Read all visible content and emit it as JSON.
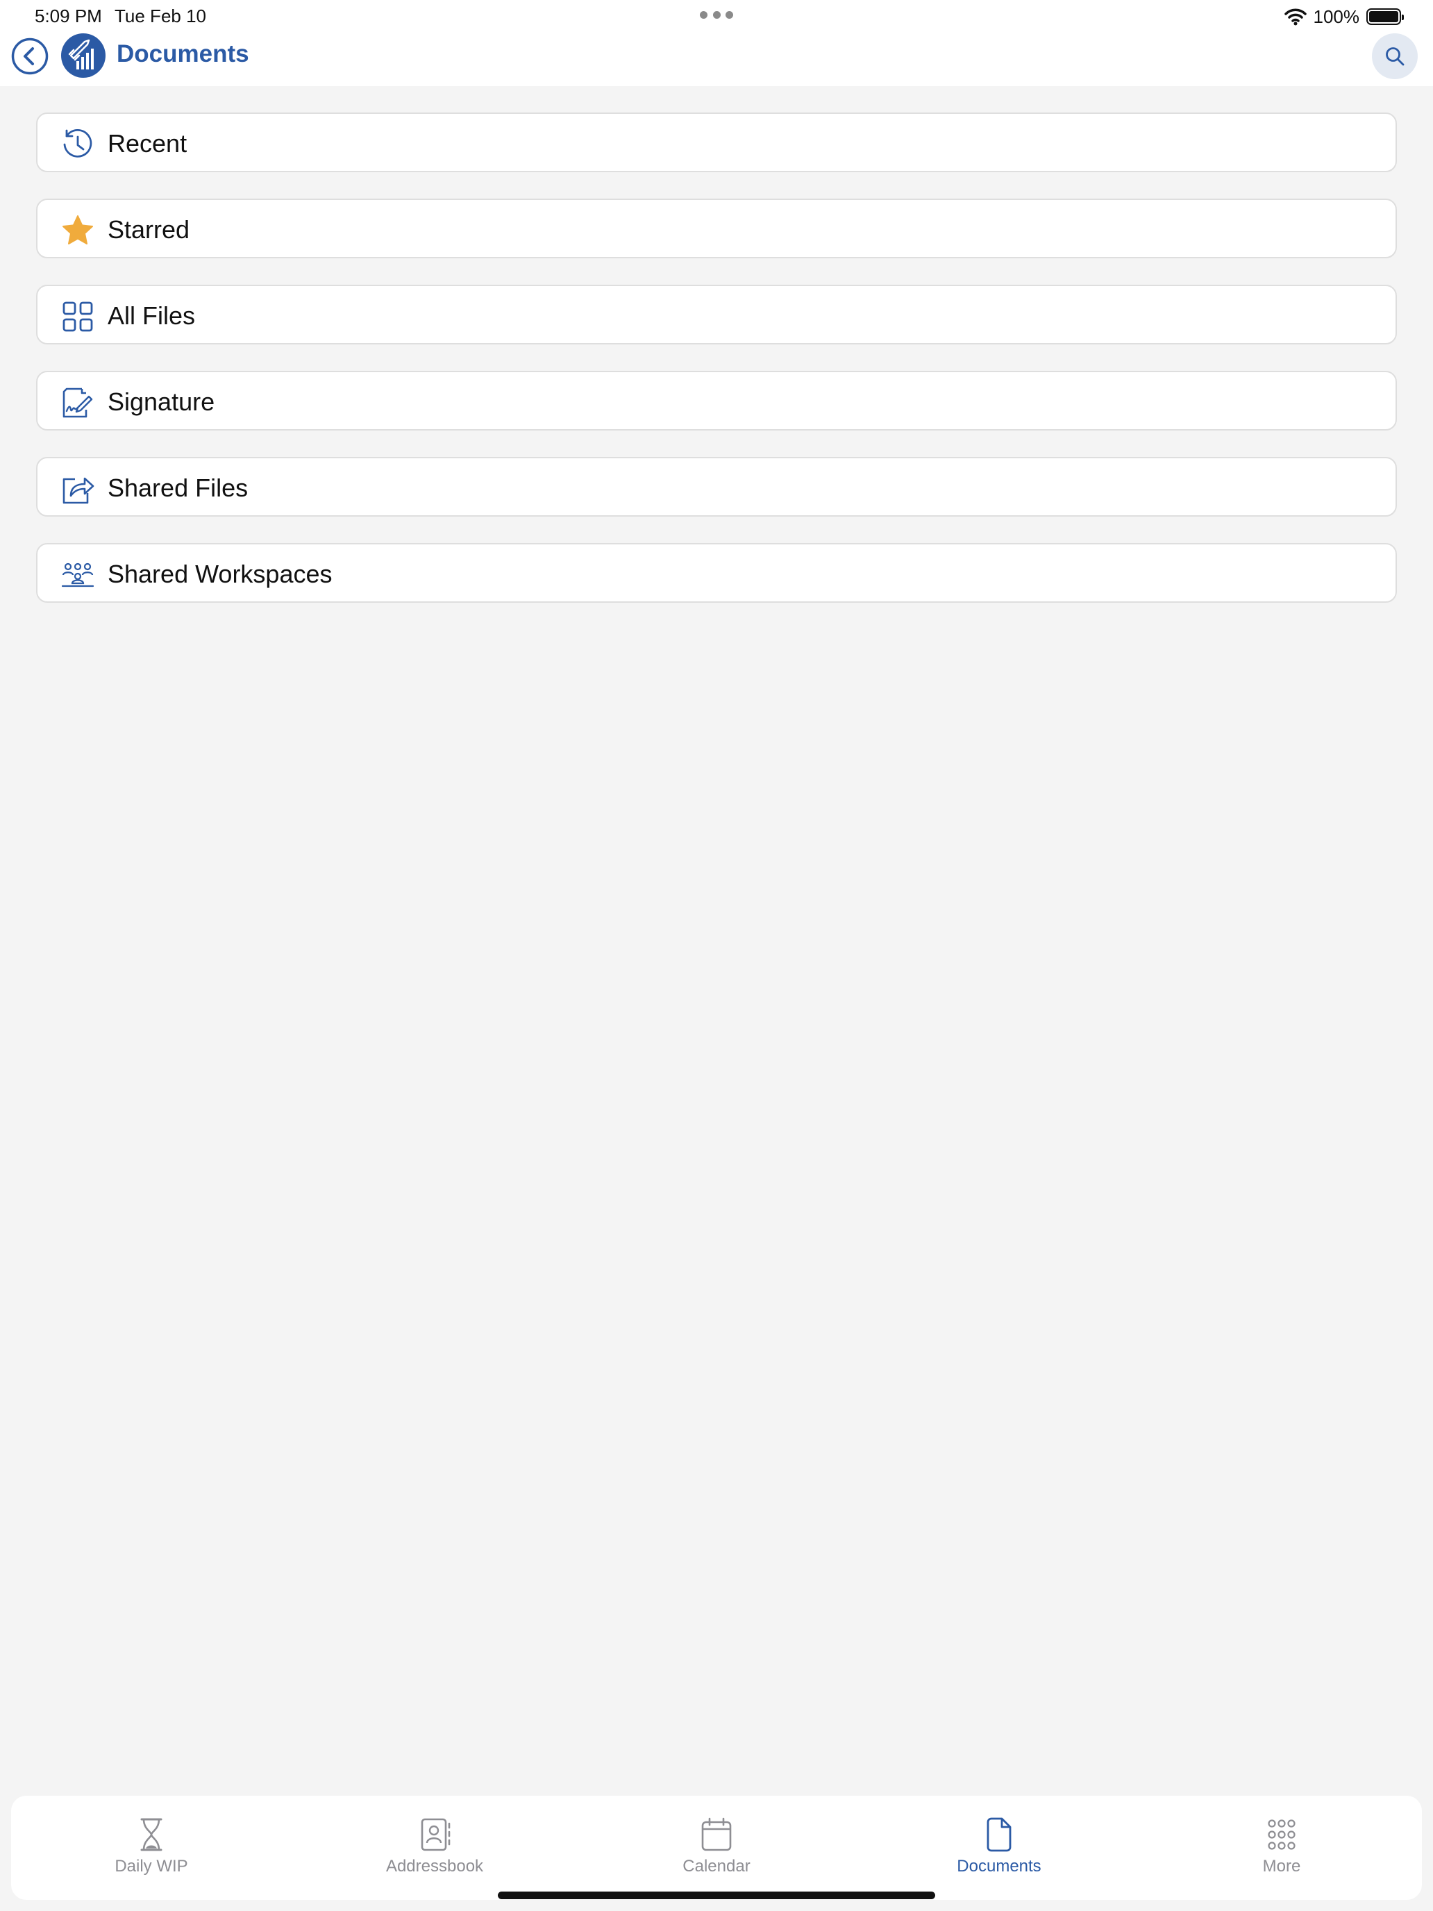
{
  "status_bar": {
    "time": "5:09 PM",
    "date": "Tue Feb 10",
    "battery": "100%"
  },
  "header": {
    "title": "Documents",
    "back_icon": "chevron-left-icon",
    "search_icon": "search-icon"
  },
  "list": {
    "items": [
      {
        "label": "Recent",
        "icon": "history-icon"
      },
      {
        "label": "Starred",
        "icon": "star-icon"
      },
      {
        "label": "All Files",
        "icon": "grid-icon"
      },
      {
        "label": "Signature",
        "icon": "signature-icon"
      },
      {
        "label": "Shared Files",
        "icon": "share-icon"
      },
      {
        "label": "Shared Workspaces",
        "icon": "workspaces-icon"
      }
    ]
  },
  "tab_bar": {
    "tabs": [
      {
        "label": "Daily WIP",
        "icon": "hourglass-icon",
        "active": false
      },
      {
        "label": "Addressbook",
        "icon": "addressbook-icon",
        "active": false
      },
      {
        "label": "Calendar",
        "icon": "calendar-icon",
        "active": false
      },
      {
        "label": "Documents",
        "icon": "document-icon",
        "active": true
      },
      {
        "label": "More",
        "icon": "more-grid-icon",
        "active": false
      }
    ]
  },
  "colors": {
    "accent": "#2b5aa5",
    "star": "#f0ab3c",
    "inactive": "#8e8e93",
    "background": "#f4f4f4"
  }
}
